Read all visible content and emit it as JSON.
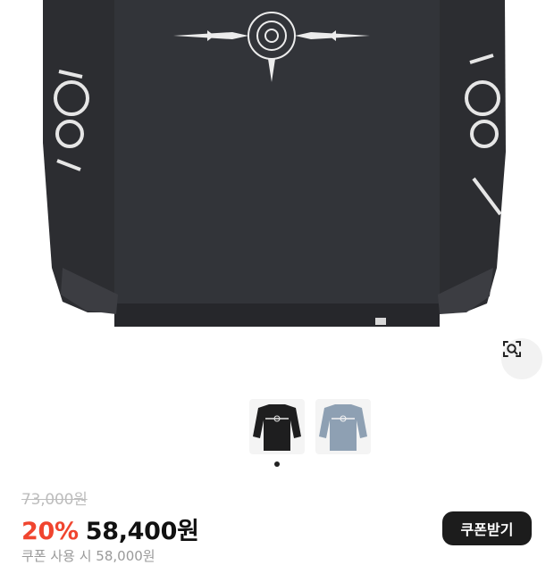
{
  "product_image": {
    "alt": "",
    "main_color": "#2a2b2e",
    "print_color": "#e9e9e9"
  },
  "image_search": {
    "icon": "lens-search-icon"
  },
  "thumbnails": [
    {
      "icon": "black-sweatshirt-thumb",
      "color": "#1e1e1f"
    },
    {
      "icon": "blue-sweatshirt-thumb",
      "color": "#8ea0b3"
    }
  ],
  "pager": {
    "active_index": 0,
    "count": 1
  },
  "price": {
    "original": "73,000원",
    "discount": "20%",
    "final": "58,400원",
    "discount_color": "#f0452f"
  },
  "coupon": {
    "button_label": "쿠폰받기",
    "note": "쿠폰 사용 시 58,000원"
  }
}
